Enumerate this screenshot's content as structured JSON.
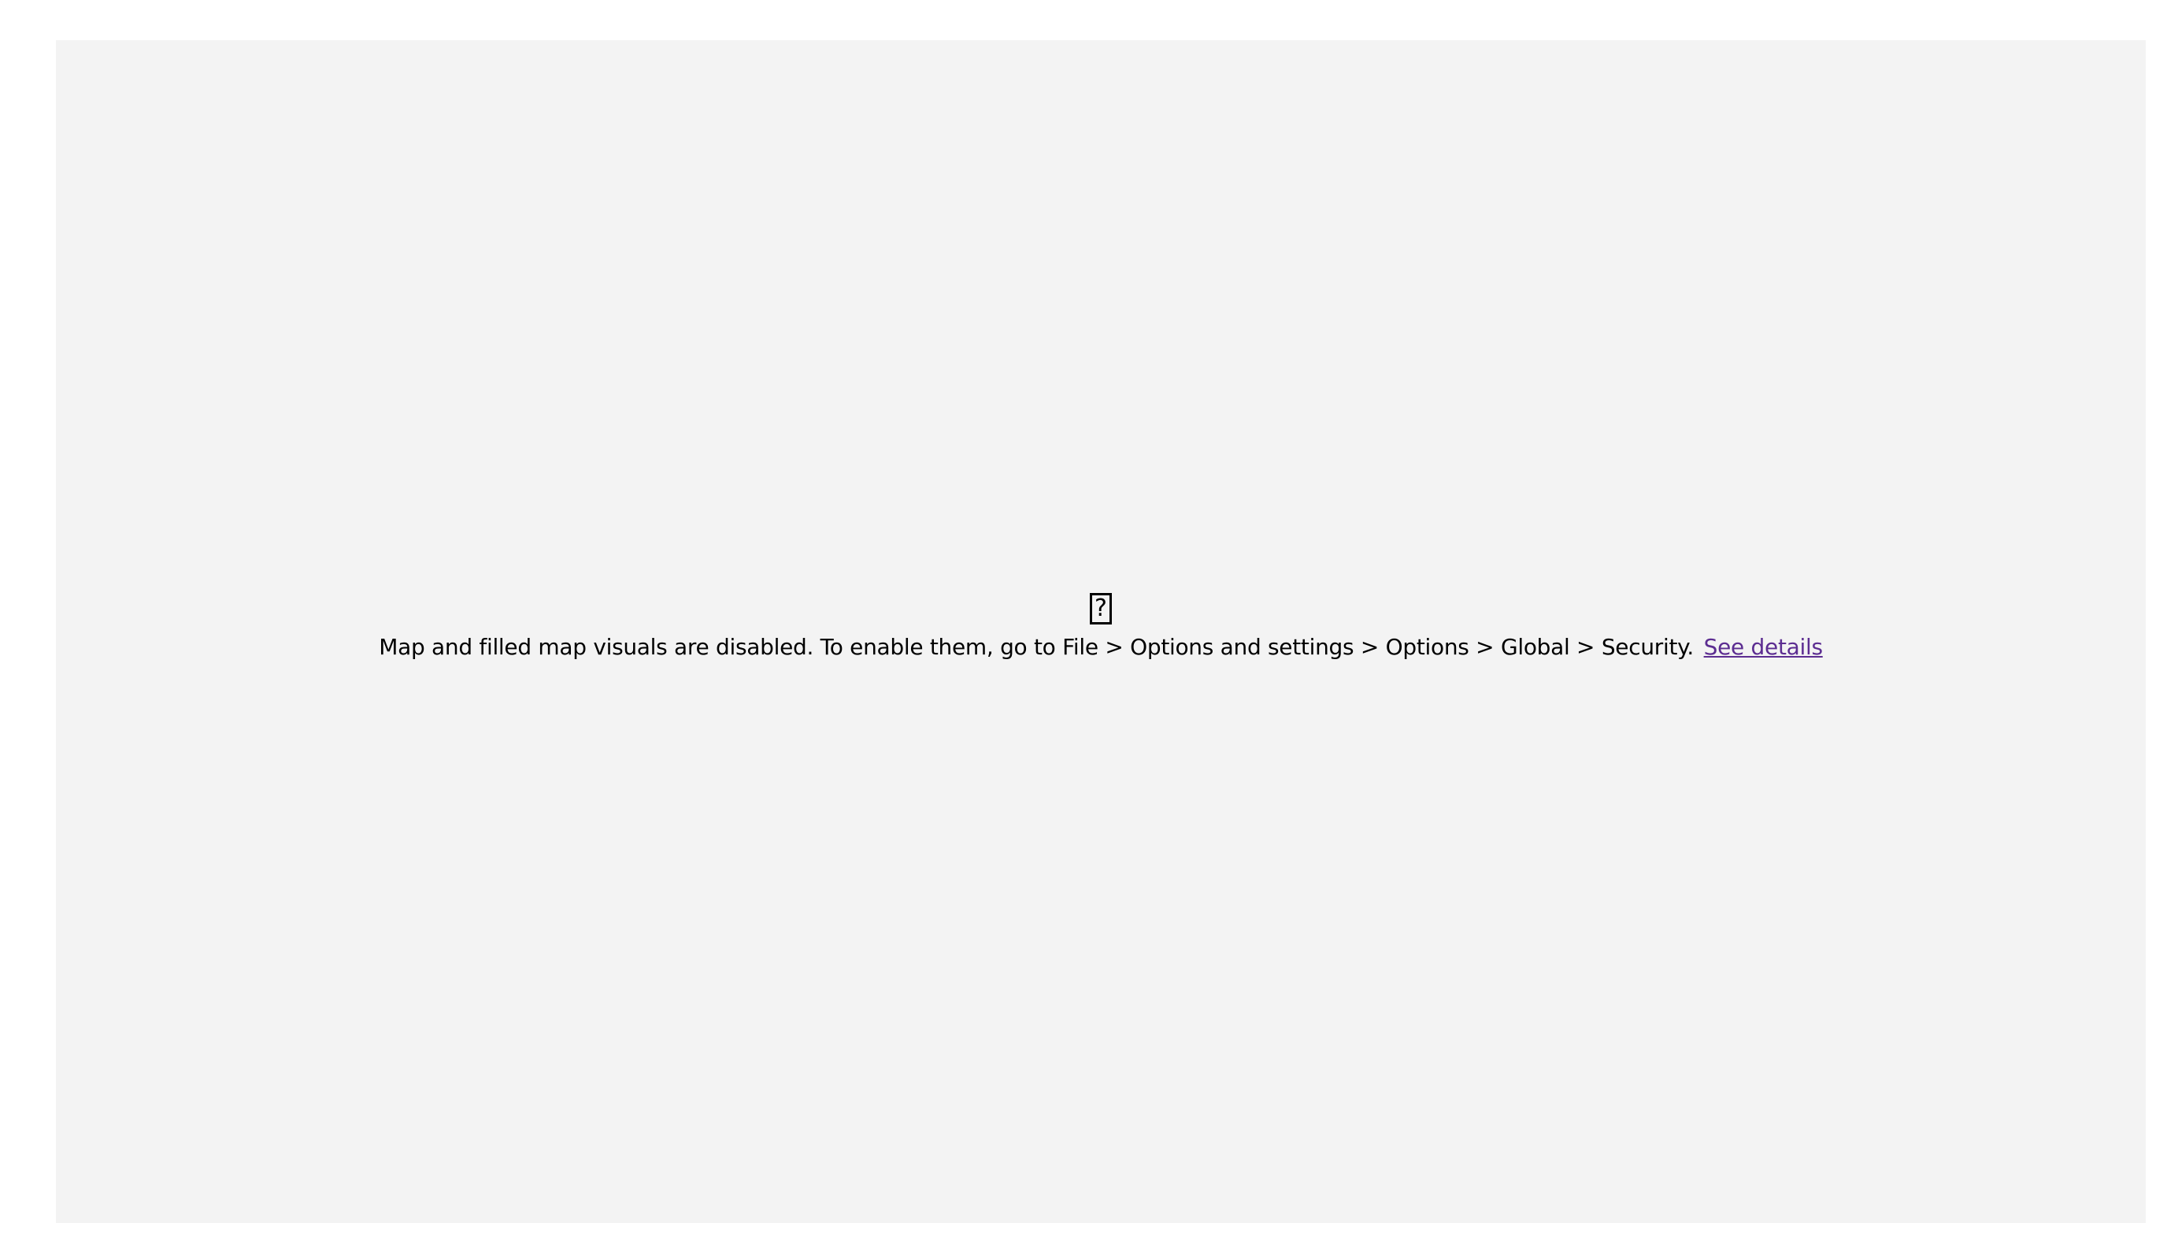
{
  "placeholder": {
    "icon": "question-mark-icon",
    "icon_glyph": "?",
    "message": "Map and filled map visuals are disabled. To enable them, go to File > Options and settings > Options > Global > Security.",
    "link_label": "See details"
  },
  "colors": {
    "canvas_background": "#f3f3f3",
    "link": "#5c2d91",
    "text": "#000000"
  }
}
